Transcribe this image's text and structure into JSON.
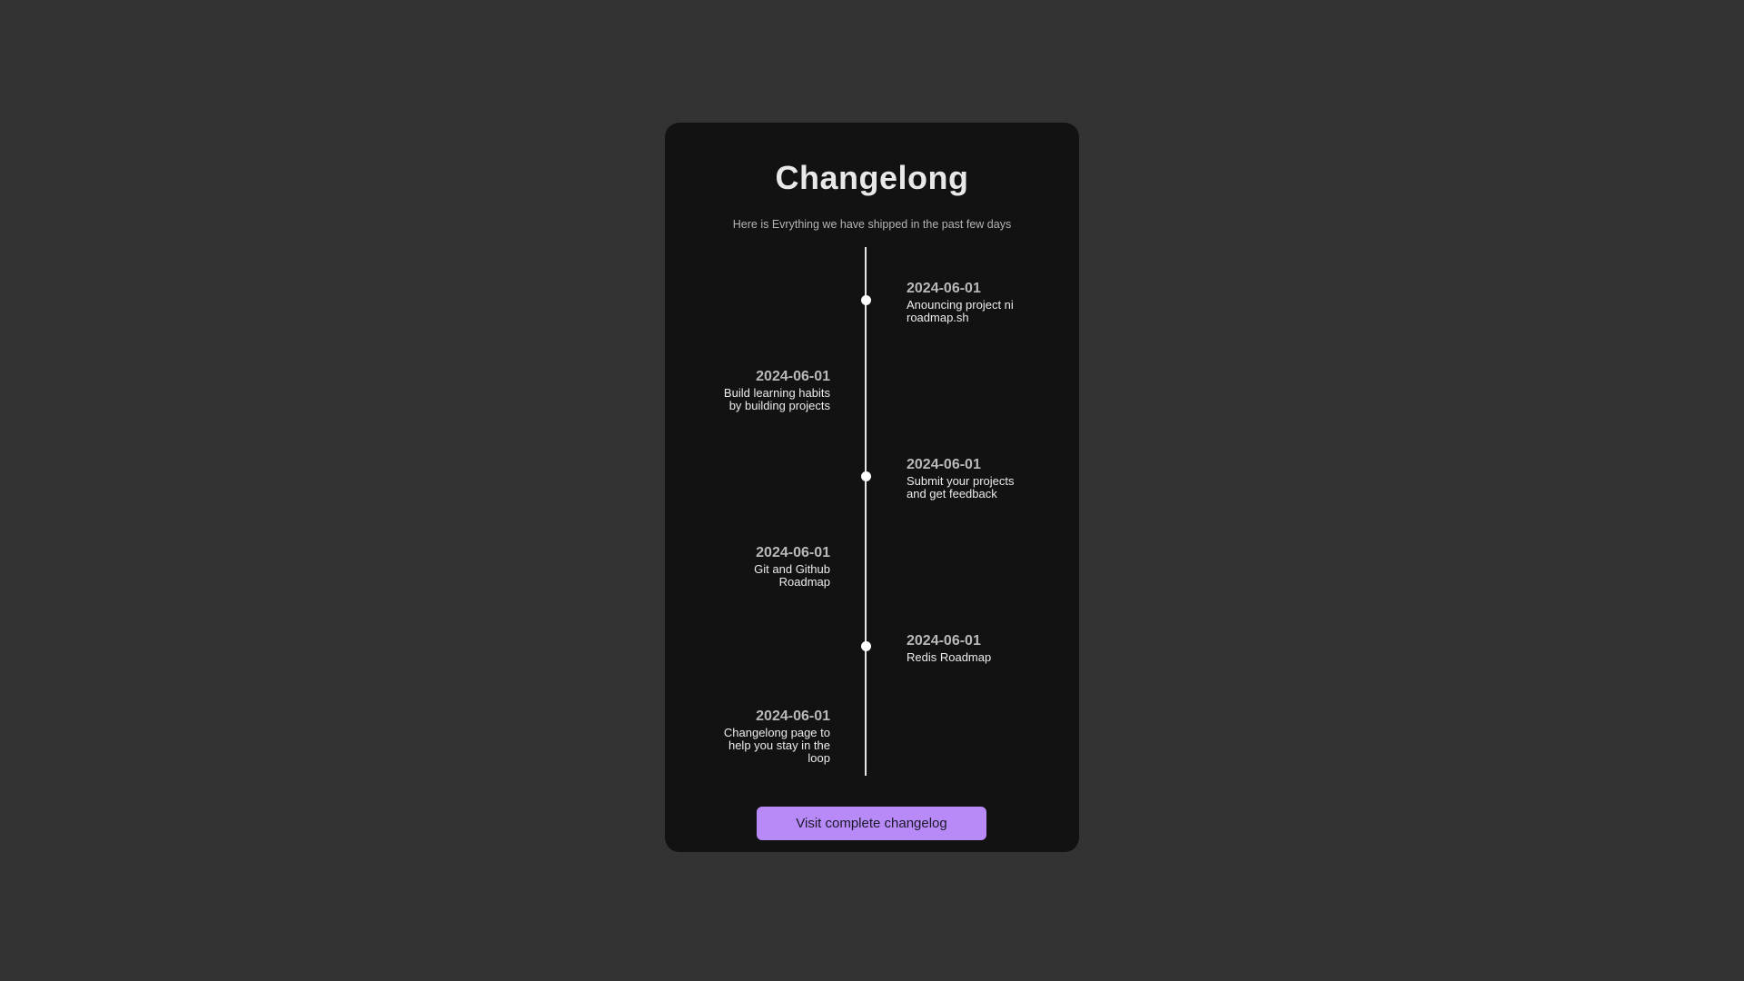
{
  "header": {
    "title": "Changelong",
    "subtitle": "Here is Evrything we have shipped in the past few days"
  },
  "timeline": {
    "entries": [
      {
        "date": "2024-06-01",
        "text": "Anouncing project ni roadmap.sh",
        "side": "right"
      },
      {
        "date": "2024-06-01",
        "text": "Build learning habits by building projects",
        "side": "left"
      },
      {
        "date": "2024-06-01",
        "text": "Submit your projects and get feedback",
        "side": "right"
      },
      {
        "date": "2024-06-01",
        "text": "Git and Github Roadmap",
        "side": "left"
      },
      {
        "date": "2024-06-01",
        "text": "Redis Roadmap",
        "side": "right"
      },
      {
        "date": "2024-06-01",
        "text": "Changelong page to help you stay in the loop",
        "side": "left"
      }
    ]
  },
  "footer": {
    "button_label": "Visit complete changelog"
  },
  "colors": {
    "page_background": "#333333",
    "card_background": "#121212",
    "accent": "#b88af7",
    "timeline": "#e6e6e6"
  }
}
